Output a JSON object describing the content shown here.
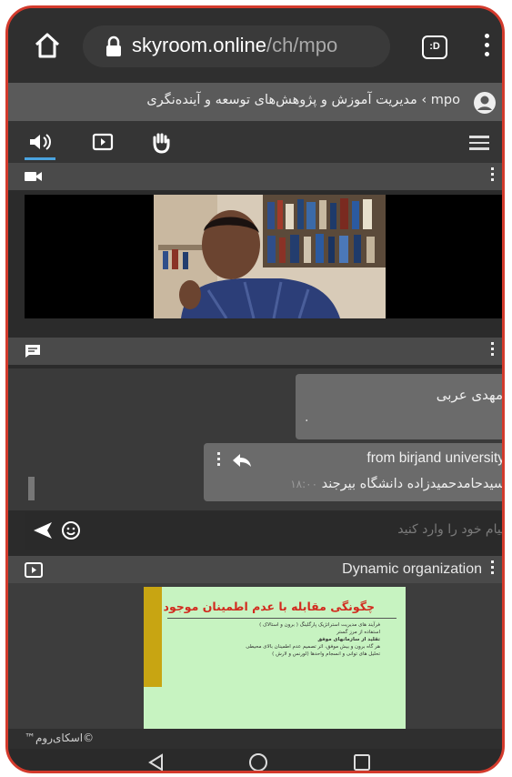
{
  "browser": {
    "url_host": "skyroom.online",
    "url_path": "/ch/mpo",
    "tab_badge": ":D"
  },
  "room": {
    "title": "mpo › مدیریت آموزش و پژوهش‌های توسعه و آینده‌نگری"
  },
  "toolbar": {
    "items": [
      "speaker-icon",
      "presentation-icon",
      "raise-hand-icon"
    ],
    "active_index": 0,
    "accent": "#4aa3df"
  },
  "chat": {
    "messages": [
      {
        "author": "مهدی عربی",
        "text": "."
      },
      {
        "from": "from birjand university",
        "text": "سیدحامدحمیدزاده دانشگاه بیرجند",
        "time": "۱۸:۰۰"
      }
    ],
    "input_placeholder": "پیام خود را وارد کنید"
  },
  "presentation": {
    "title": "Dynamic organization",
    "slide": {
      "heading": "چگونگی مقابله با عدم اطمینان موجود",
      "bullets": [
        "فرآیند های مدیریت استراتژیک پارگلینگ ( برون و استالاک )",
        "استفاده از مرز گستر",
        "تقلید از سازمانهای موفق",
        "هر گاه برون و بیش موفق، اثر تصمیم عدم اطمینان بالای محیطی",
        "تحلیل های توانی و انسجام واحدها (لورنس و لارش )"
      ]
    }
  },
  "footer": {
    "brand": "©اسکای‌روم™"
  }
}
